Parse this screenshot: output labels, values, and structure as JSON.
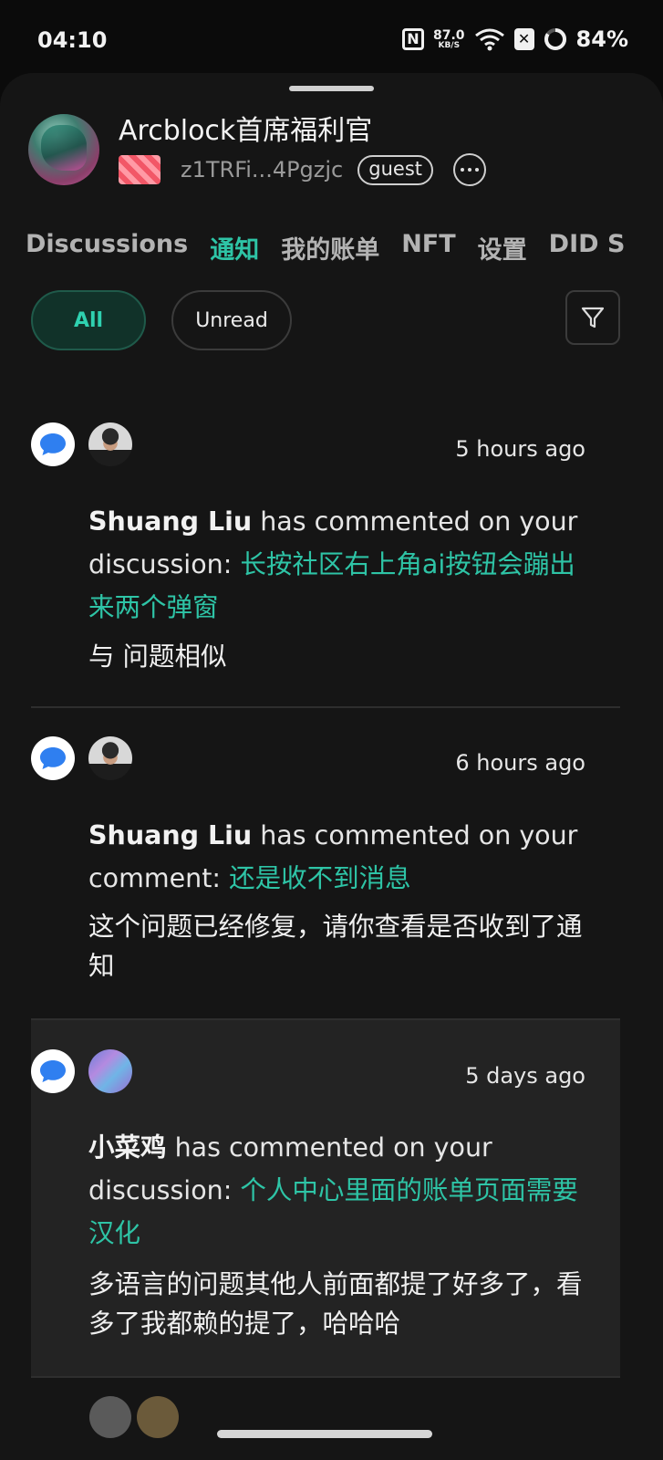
{
  "status_bar": {
    "time": "04:10",
    "net_speed_value": "87.0",
    "net_speed_unit": "KB/S",
    "battery": "84%",
    "icons": [
      "nfc-icon",
      "wifi-icon",
      "sim-x-icon",
      "battery-ring-icon"
    ]
  },
  "profile": {
    "name": "Arcblock首席福利官",
    "did": "z1TRFi...4Pgzjc",
    "role_badge": "guest"
  },
  "tabs": [
    {
      "label": "Discussions",
      "active": false
    },
    {
      "label": "通知",
      "active": true
    },
    {
      "label": "我的账单",
      "active": false
    },
    {
      "label": "NFT",
      "active": false
    },
    {
      "label": "设置",
      "active": false
    },
    {
      "label": "DID S",
      "active": false
    }
  ],
  "filters": {
    "all": "All",
    "unread": "Unread",
    "selected": "All"
  },
  "notifications": [
    {
      "time": "5 hours ago",
      "actor": "Shuang Liu",
      "action": " has commented on your discussion: ",
      "link": "长按社区右上角ai按钮会蹦出来两个弹窗",
      "body": "与 问题相似",
      "highlighted": false
    },
    {
      "time": "6 hours ago",
      "actor": "Shuang Liu",
      "action": " has commented on your comment: ",
      "link": "还是收不到消息",
      "body": "这个问题已经修复，请你查看是否收到了通知",
      "highlighted": false
    },
    {
      "time": "5 days ago",
      "actor": "小菜鸡",
      "action": " has commented on your discussion: ",
      "link": "个人中心里面的账单页面需要汉化",
      "body": "多语言的问题其他人前面都提了好多了，看多了我都赖的提了，哈哈哈",
      "highlighted": true
    }
  ],
  "colors": {
    "accent": "#2ec4a6",
    "background": "#151515",
    "highlight_row": "#232323"
  }
}
